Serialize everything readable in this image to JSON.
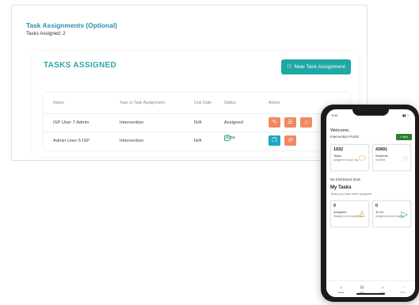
{
  "section": {
    "title": "Task Assignments (Optional)",
    "assigned_count_label": "Tasks Assigned: 2"
  },
  "panel": {
    "heading": "TASKS ASSIGNED",
    "new_button_label": "New Task Assignment",
    "new_button_icon": "add-user-icon"
  },
  "table": {
    "columns": [
      "Name",
      "Task or Task Assignment",
      "Due Date",
      "Status",
      "Action"
    ],
    "rows": [
      {
        "name": "ISP User 7 Admin",
        "task": "Intervention",
        "due": "N/A",
        "status": "Assigned",
        "actions": [
          "edit-icon",
          "list-icon",
          "delete-icon"
        ]
      },
      {
        "name": "Admin User 5 ISP",
        "task": "Intervention",
        "due": "N/A",
        "status": "Done",
        "actions": [
          "copy-icon",
          "undo-icon"
        ]
      }
    ]
  },
  "phone": {
    "time": "9:41",
    "welcome": "Welcome,",
    "subtitle": "Intervention Portal",
    "button": "+ New",
    "stats": [
      {
        "value": "1932",
        "label": "Tasks",
        "sub": "Assigned to your org",
        "icon": "pill-icon"
      },
      {
        "value": "43991",
        "label": "Students",
        "sub": "enrolled",
        "icon": "ring-icon"
      }
    ],
    "section_note": "My Dashboard Stats",
    "my_tasks_title": "My Tasks",
    "my_tasks_sub": "Tasks you have been assigned",
    "task_cards": [
      {
        "value": "0",
        "label": "Assigned",
        "sub": "Waiting to be completed",
        "icon": "person-icon"
      },
      {
        "value": "0",
        "label": "To Do",
        "sub": "Assignments not started",
        "icon": "play-icon"
      }
    ],
    "tabs": [
      "Home",
      "Tasks",
      "Users",
      "More"
    ]
  },
  "colors": {
    "accent_teal": "#1fa8a5",
    "title_blue": "#2e8ea8",
    "action_orange": "#f08a63",
    "action_teal": "#1aa8c4",
    "done_green": "#2ab07f"
  }
}
